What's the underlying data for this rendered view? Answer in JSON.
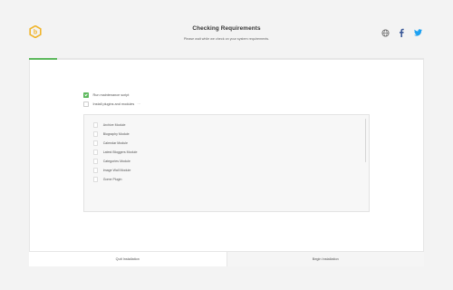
{
  "header": {
    "title": "Checking Requirements",
    "subtitle": "Please wait while we check on your system requirements."
  },
  "icons": {
    "logo": "hexagon-b-logo",
    "globe": "globe-icon",
    "facebook": "facebook-icon",
    "twitter": "twitter-icon"
  },
  "colors": {
    "accent": "#5cb85c",
    "logo": "#f0b429",
    "facebook": "#3b5998",
    "twitter": "#1da1f2"
  },
  "progress": {
    "fraction": 0.07
  },
  "options": [
    {
      "label": "Run maintenance script",
      "checked": true
    },
    {
      "label": "Install plugins and modules",
      "checked": false,
      "suffix": "···"
    }
  ],
  "modules": [
    {
      "label": "Archive Module"
    },
    {
      "label": "Biography Module"
    },
    {
      "label": "Calendar Module"
    },
    {
      "label": "Latest Bloggers Module"
    },
    {
      "label": "Categories Module"
    },
    {
      "label": "Image Wall Module"
    },
    {
      "label": "Gome Plugin"
    }
  ],
  "footer": {
    "quit_label": "Quit Installation",
    "begin_label": "Begin Installation"
  }
}
